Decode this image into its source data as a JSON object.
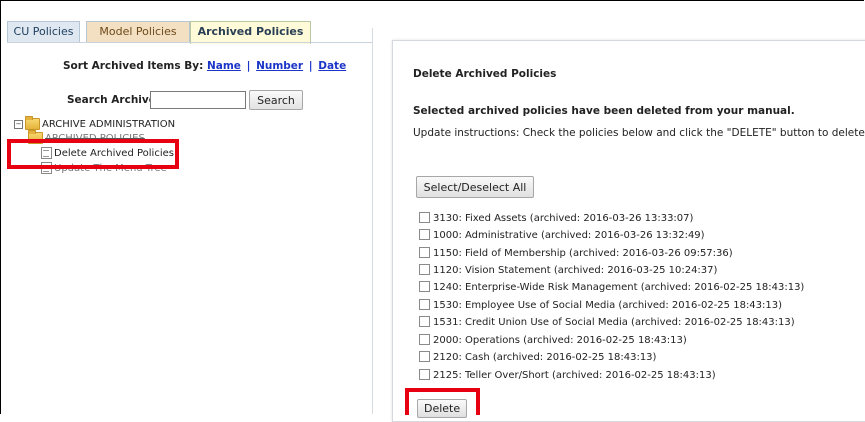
{
  "tabs": [
    {
      "label": "CU Policies"
    },
    {
      "label": "Model Policies"
    },
    {
      "label": "Archived Policies"
    }
  ],
  "sort": {
    "label": "Sort Archived Items By:",
    "options": [
      "Name",
      "Number",
      "Date"
    ],
    "separator": "|"
  },
  "search": {
    "label": "Search Archive:",
    "value": "",
    "button": "Search"
  },
  "tree": {
    "root": "ARCHIVE ADMINISTRATION",
    "toggle": "−",
    "obscured_folder": "ARCHIVED POLICIES",
    "delete_item": "Delete Archived Policies",
    "update_item": "Update The Menu Tree"
  },
  "panel": {
    "title": "Delete Archived Policies",
    "message": "Selected archived policies have been deleted from your manual.",
    "instructions": "Update instructions: Check the policies below and click the \"DELETE\" button to delete",
    "select_all_button": "Select/Deselect All",
    "delete_button": "Delete",
    "policies": [
      {
        "label": "3130: Fixed Assets (archived: 2016-03-26 13:33:07)",
        "checked": false
      },
      {
        "label": "1000: Administrative (archived: 2016-03-26 13:32:49)",
        "checked": false
      },
      {
        "label": "1150: Field of Membership (archived: 2016-03-26 09:57:36)",
        "checked": false
      },
      {
        "label": "1120: Vision Statement (archived: 2016-03-25 10:24:37)",
        "checked": false
      },
      {
        "label": "1240: Enterprise-Wide Risk Management (archived: 2016-02-25 18:43:13)",
        "checked": false
      },
      {
        "label": "1530: Employee Use of Social Media (archived: 2016-02-25 18:43:13)",
        "checked": false
      },
      {
        "label": "1531: Credit Union Use of Social Media (archived: 2016-02-25 18:43:13)",
        "checked": false
      },
      {
        "label": "2000: Operations (archived: 2016-02-25 18:43:13)",
        "checked": false
      },
      {
        "label": "2120: Cash (archived: 2016-02-25 18:43:13)",
        "checked": false
      },
      {
        "label": "2125: Teller Over/Short (archived: 2016-02-25 18:43:13)",
        "checked": false
      }
    ]
  },
  "colors": {
    "highlight": "#e60012",
    "link": "#1a35c8"
  }
}
